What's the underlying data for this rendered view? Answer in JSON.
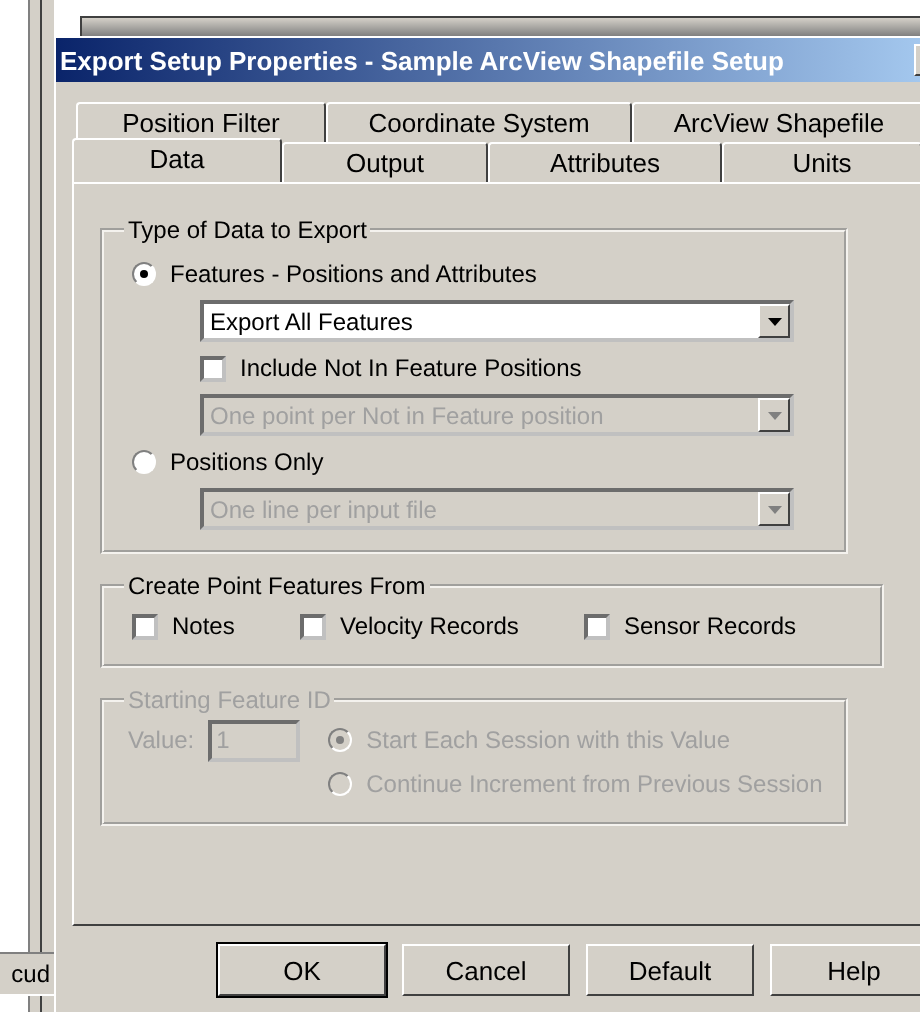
{
  "background_window": {
    "text": "cud"
  },
  "window": {
    "title": "Export Setup Properties - Sample ArcView Shapefile Setup"
  },
  "tab_rows": [
    {
      "tabs": [
        {
          "label": "Position Filter",
          "selected": false
        },
        {
          "label": "Coordinate System",
          "selected": false
        },
        {
          "label": "ArcView Shapefile",
          "selected": false
        }
      ]
    },
    {
      "tabs": [
        {
          "label": "Data",
          "selected": true
        },
        {
          "label": "Output",
          "selected": false
        },
        {
          "label": "Attributes",
          "selected": false
        },
        {
          "label": "Units",
          "selected": false
        }
      ]
    }
  ],
  "type_group": {
    "title": "Type of Data to Export",
    "options": [
      {
        "label": "Features - Positions and Attributes",
        "selected": true,
        "children": [
          {
            "kind": "dropdown",
            "value": "Export All Features",
            "disabled": false
          },
          {
            "kind": "checkbox",
            "label": "Include Not In Feature Positions",
            "checked": false
          },
          {
            "kind": "dropdown",
            "value": "One point per Not in Feature position",
            "disabled": true
          }
        ]
      },
      {
        "label": "Positions Only",
        "selected": false,
        "children": [
          {
            "kind": "dropdown",
            "value": "One line per input file",
            "disabled": true
          }
        ]
      }
    ]
  },
  "point_group": {
    "title": "Create Point Features From",
    "checkboxes": [
      {
        "label": "Notes",
        "checked": false
      },
      {
        "label": "Velocity Records",
        "checked": false
      },
      {
        "label": "Sensor Records",
        "checked": false
      }
    ]
  },
  "id_group": {
    "title": "Starting Feature ID",
    "disabled": true,
    "value_label": "Value:",
    "value": "1",
    "options": [
      {
        "label": "Start Each Session with this Value",
        "selected": true
      },
      {
        "label": "Continue Increment from Previous Session",
        "selected": false
      }
    ]
  },
  "buttons": [
    {
      "label": "OK",
      "default": true
    },
    {
      "label": "Cancel",
      "default": false
    },
    {
      "label": "Default",
      "default": false
    },
    {
      "label": "Help",
      "default": false
    }
  ]
}
